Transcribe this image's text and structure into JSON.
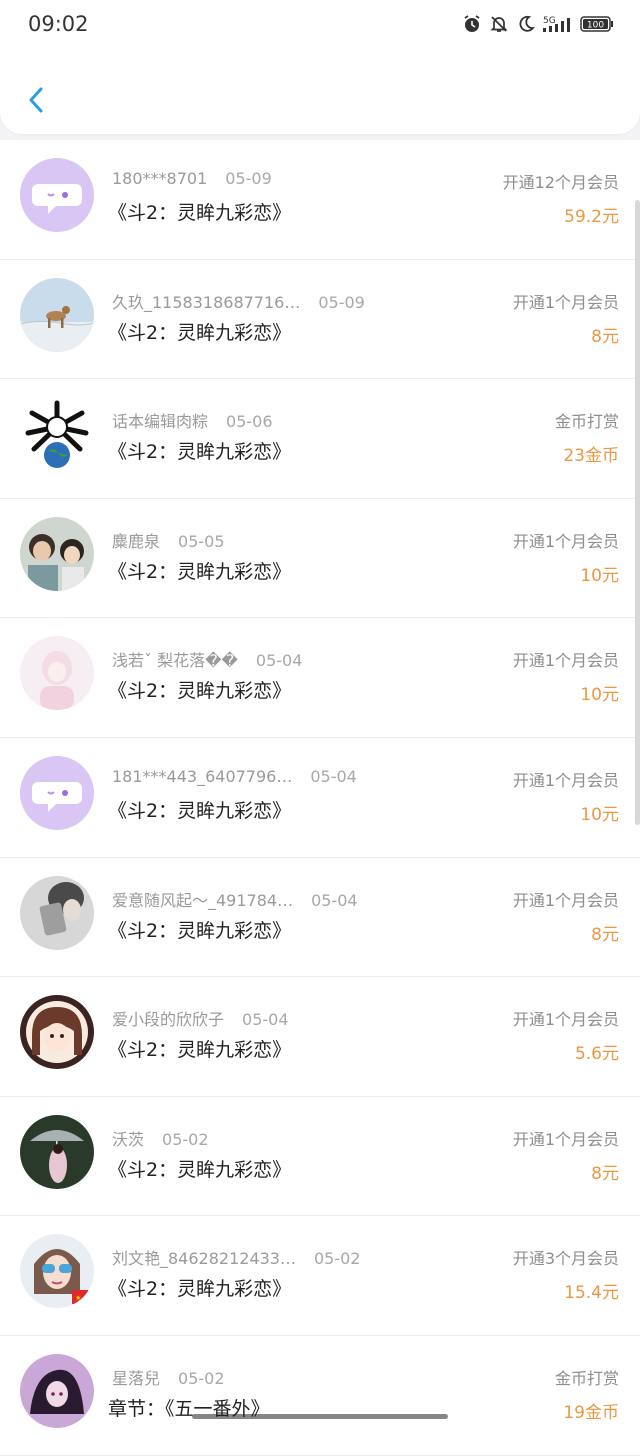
{
  "status_bar": {
    "time": "09:02",
    "icons": [
      "alarm-icon",
      "bell-off-icon",
      "moon-icon",
      "signal-5g-icon",
      "battery-icon"
    ],
    "battery": "100",
    "network": "5G"
  },
  "header": {
    "back_icon": "chevron-left-icon"
  },
  "colors": {
    "accent": "#2a9ee0",
    "amount": "#ec9743",
    "default_avatar": "#d9c6f5"
  },
  "records": [
    {
      "user": "180***8701",
      "date": "05-09",
      "title": "《斗2：灵眸九彩恋》",
      "action": "开通12个月会员",
      "amount": "59.2元",
      "avatar": "default-chat-avatar"
    },
    {
      "user": "久玖_1158318687716…",
      "date": "05-09",
      "title": "《斗2：灵眸九彩恋》",
      "action": "开通1个月会员",
      "amount": "8元",
      "avatar": "dog-photo-avatar"
    },
    {
      "user": "话本编辑肉粽",
      "date": "05-06",
      "title": "《斗2：灵眸九彩恋》",
      "action": "金币打赏",
      "amount": "23金币",
      "avatar": "bones-earth-avatar"
    },
    {
      "user": "麋鹿泉",
      "date": "05-05",
      "title": "《斗2：灵眸九彩恋》",
      "action": "开通1个月会员",
      "amount": "10元",
      "avatar": "boys-photo-avatar"
    },
    {
      "user": "浅若ˇ 梨花落��",
      "date": "05-04",
      "title": "《斗2：灵眸九彩恋》",
      "action": "开通1个月会员",
      "amount": "10元",
      "avatar": "pink-girl-avatar"
    },
    {
      "user": "181***443_6407796…",
      "date": "05-04",
      "title": "《斗2：灵眸九彩恋》",
      "action": "开通1个月会员",
      "amount": "10元",
      "avatar": "default-chat-avatar"
    },
    {
      "user": "爱意随风起～_491784…",
      "date": "05-04",
      "title": "《斗2：灵眸九彩恋》",
      "action": "开通1个月会员",
      "amount": "8元",
      "avatar": "bw-photo-avatar"
    },
    {
      "user": "爱小段的欣欣子",
      "date": "05-04",
      "title": "《斗2：灵眸九彩恋》",
      "action": "开通1个月会员",
      "amount": "5.6元",
      "avatar": "anime-girl-avatar"
    },
    {
      "user": "沃茨",
      "date": "05-02",
      "title": "《斗2：灵眸九彩恋》",
      "action": "开通1个月会员",
      "amount": "8元",
      "avatar": "umbrella-photo-avatar"
    },
    {
      "user": "刘文艳_84628212433…",
      "date": "05-02",
      "title": "《斗2：灵眸九彩恋》",
      "action": "开通3个月会员",
      "amount": "15.4元",
      "avatar": "sunglasses-avatar"
    },
    {
      "user": "星落兒",
      "date": "05-02",
      "title": "章节：《五一番外》",
      "action": "金币打赏",
      "amount": "19金币",
      "avatar": "dark-anime-avatar"
    }
  ]
}
